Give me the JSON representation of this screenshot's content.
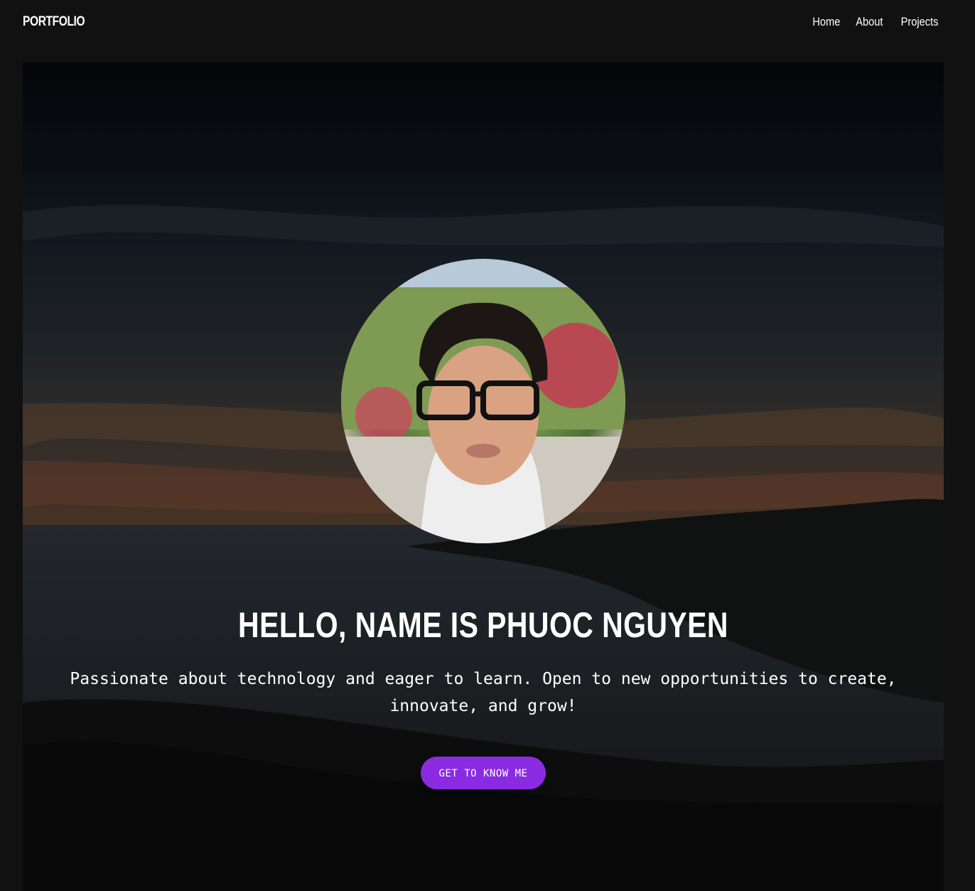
{
  "navbar": {
    "brand": "PORTFOLIO",
    "links": [
      "Home",
      "About",
      "Projects"
    ]
  },
  "hero": {
    "headline": "HELLO, NAME IS PHUOC NGUYEN",
    "tagline": "Passionate about technology and eager to learn. Open to new opportunities to create, innovate, and grow!",
    "cta_label": "GET TO KNOW ME"
  },
  "colors": {
    "page_background": "#111111",
    "cta_background": "#8a2be2",
    "text": "#ffffff"
  }
}
